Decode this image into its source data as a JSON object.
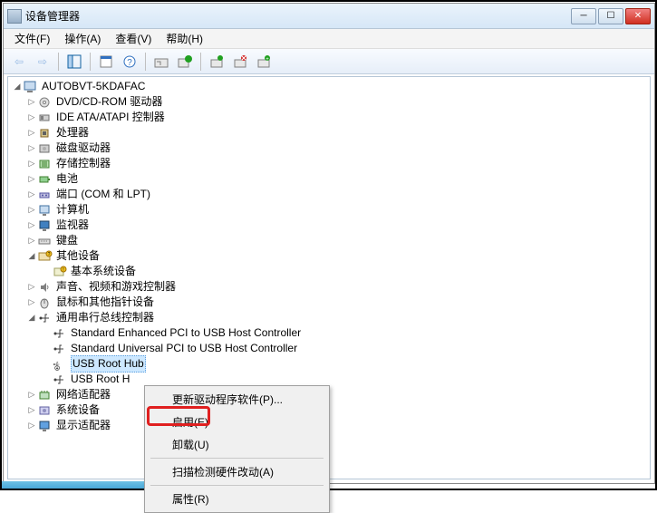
{
  "window": {
    "title": "设备管理器"
  },
  "menu": {
    "file": "文件(F)",
    "action": "操作(A)",
    "view": "查看(V)",
    "help": "帮助(H)"
  },
  "tree": {
    "root": "AUTOBVT-5KDAFAC",
    "items": [
      {
        "label": "DVD/CD-ROM 驱动器",
        "icon": "disc"
      },
      {
        "label": "IDE ATA/ATAPI 控制器",
        "icon": "ide"
      },
      {
        "label": "处理器",
        "icon": "cpu"
      },
      {
        "label": "磁盘驱动器",
        "icon": "disk"
      },
      {
        "label": "存储控制器",
        "icon": "storage"
      },
      {
        "label": "电池",
        "icon": "battery"
      },
      {
        "label": "端口 (COM 和 LPT)",
        "icon": "port"
      },
      {
        "label": "计算机",
        "icon": "computer"
      },
      {
        "label": "监视器",
        "icon": "monitor"
      },
      {
        "label": "键盘",
        "icon": "keyboard"
      }
    ],
    "other_devices_label": "其他设备",
    "other_devices_child": "基本系统设备",
    "more_items": [
      {
        "label": "声音、视频和游戏控制器",
        "icon": "sound"
      },
      {
        "label": "鼠标和其他指针设备",
        "icon": "mouse"
      }
    ],
    "usb_group_label": "通用串行总线控制器",
    "usb_children": [
      "Standard Enhanced PCI to USB Host Controller",
      "Standard Universal PCI to USB Host Controller",
      "USB Root Hub",
      "USB Root H"
    ],
    "bottom_items": [
      {
        "label": "网络适配器",
        "icon": "network"
      },
      {
        "label": "系统设备",
        "icon": "system"
      },
      {
        "label": "显示适配器",
        "icon": "display"
      }
    ]
  },
  "context_menu": {
    "update_driver": "更新驱动程序软件(P)...",
    "enable": "启用(E)",
    "uninstall": "卸载(U)",
    "scan": "扫描检测硬件改动(A)",
    "properties": "属性(R)"
  }
}
